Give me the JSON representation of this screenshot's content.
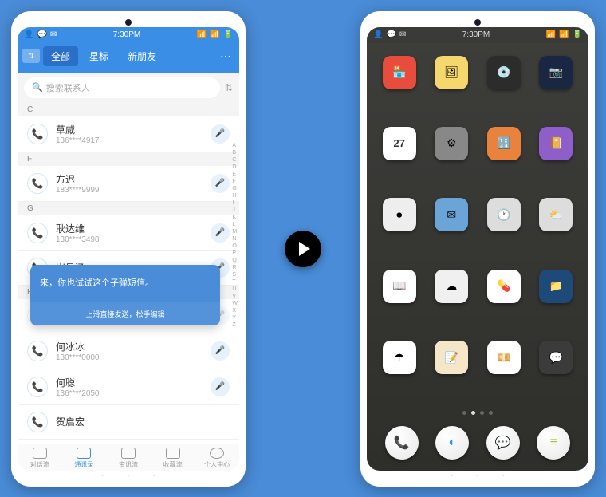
{
  "statusbar": {
    "time": "7:30PM"
  },
  "contacts_app": {
    "tabs": [
      "全部",
      "星标",
      "新朋友"
    ],
    "search_placeholder": "搜索联系人",
    "sections": {
      "C": [
        {
          "name": "草威",
          "number": "136****4917"
        }
      ],
      "F": [
        {
          "name": "方迟",
          "number": "183****9999"
        }
      ],
      "G": [
        {
          "name": "耿达维",
          "number": "130****3498"
        },
        {
          "name": "崔显涵",
          "number": ""
        }
      ],
      "H": [
        {
          "name": "何冰冰",
          "number": "130****0000"
        },
        {
          "name": "何聪",
          "number": "136****2050"
        },
        {
          "name": "贺启宏",
          "number": ""
        }
      ]
    },
    "alpha_index": [
      "A",
      "B",
      "C",
      "D",
      "E",
      "F",
      "G",
      "H",
      "I",
      "J",
      "K",
      "L",
      "M",
      "N",
      "O",
      "P",
      "Q",
      "R",
      "S",
      "T",
      "U",
      "V",
      "W",
      "X",
      "Y",
      "Z"
    ],
    "popup": {
      "message": "来，你也试试这个子弹短信。",
      "hint": "上滑直接发送，松手编辑"
    },
    "bottom_nav": [
      "对话流",
      "通讯录",
      "资讯流",
      "收藏流",
      "个人中心"
    ],
    "bottom_active_index": 1
  },
  "homescreen": {
    "grid": [
      {
        "name": "store",
        "bg": "#e74c3c",
        "glyph": "🏪"
      },
      {
        "name": "photos",
        "bg": "#f5d76e",
        "glyph": "🖼"
      },
      {
        "name": "music",
        "bg": "#2c2c2c",
        "glyph": "💿"
      },
      {
        "name": "camera",
        "bg": "#1a2742",
        "glyph": "📷"
      },
      {
        "name": "calendar",
        "bg": "#fff",
        "glyph": "27"
      },
      {
        "name": "settings",
        "bg": "#888",
        "glyph": "⚙"
      },
      {
        "name": "calculator",
        "bg": "#e8823c",
        "glyph": "🔢"
      },
      {
        "name": "notes",
        "bg": "#8e5fc9",
        "glyph": "📔"
      },
      {
        "name": "recorder",
        "bg": "#eee",
        "glyph": "⏺"
      },
      {
        "name": "mail",
        "bg": "#6ba5d8",
        "glyph": "✉"
      },
      {
        "name": "clock",
        "bg": "#ddd",
        "glyph": "🕐"
      },
      {
        "name": "weather",
        "bg": "#ddd",
        "glyph": "⛅"
      },
      {
        "name": "reader",
        "bg": "#fff",
        "glyph": "📖"
      },
      {
        "name": "cloud",
        "bg": "#f0f0f0",
        "glyph": "☁"
      },
      {
        "name": "health",
        "bg": "#fff",
        "glyph": "💊"
      },
      {
        "name": "files",
        "bg": "#1e4a7a",
        "glyph": "📁"
      },
      {
        "name": "umbrella",
        "bg": "#fff",
        "glyph": "☂"
      },
      {
        "name": "memo",
        "bg": "#f5e6c8",
        "glyph": "📝"
      },
      {
        "name": "finance",
        "bg": "#fff",
        "glyph": "💴"
      },
      {
        "name": "chat",
        "bg": "#3b3b3b",
        "glyph": "💬"
      }
    ],
    "dock": [
      {
        "name": "phone",
        "glyph": "📞",
        "color": "#4caf50"
      },
      {
        "name": "browser",
        "glyph": "◐",
        "color": "#2196f3"
      },
      {
        "name": "messages",
        "glyph": "💬",
        "color": "#555"
      },
      {
        "name": "contacts",
        "glyph": "≡",
        "color": "#9ccc2f"
      }
    ]
  }
}
